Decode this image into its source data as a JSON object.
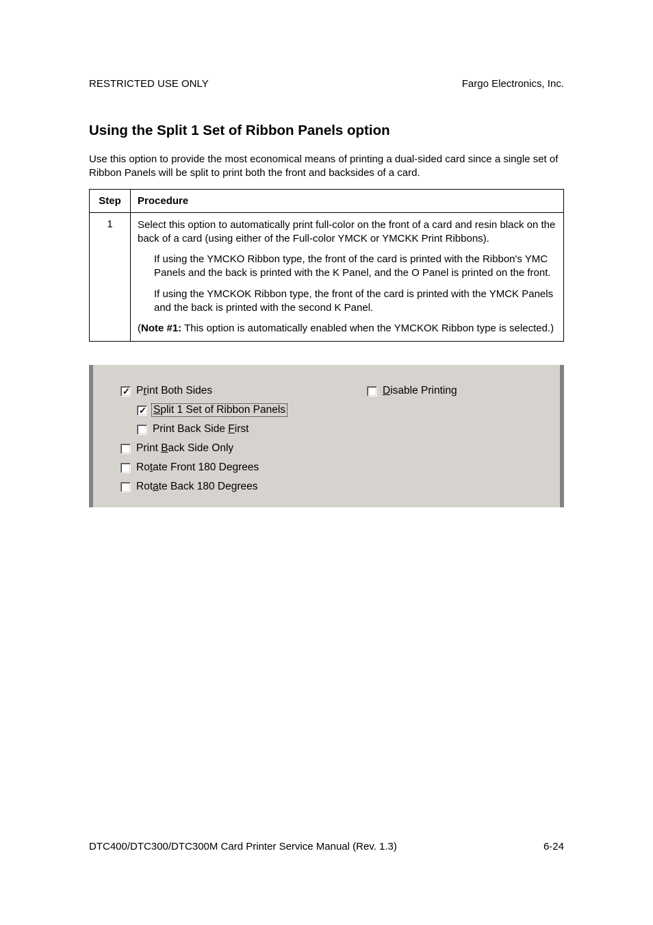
{
  "header": {
    "left": "RESTRICTED USE ONLY",
    "right": "Fargo Electronics, Inc."
  },
  "section_title": "Using the Split 1 Set of Ribbon Panels option",
  "intro": "Use this option to provide the most economical means of printing a dual-sided card since a single set of Ribbon Panels will be split to print both the front and backsides of a card.",
  "table": {
    "headers": {
      "step": "Step",
      "procedure": "Procedure"
    },
    "row": {
      "step": "1",
      "p1": "Select this option to automatically print full-color on the front of a card and resin black on the back of a card (using either of the Full-color YMCK or YMCKK Print Ribbons).",
      "p2": "If using the YMCKO Ribbon type, the front of the card is printed with the Ribbon's YMC Panels and the back is printed with the K Panel, and the O Panel is printed on the front.",
      "p3": "If using the YMCKOK Ribbon type, the front of the card is printed with the YMCK Panels and the back is printed with the second K Panel.",
      "note_label": "Note #1:",
      "note_text": "  This option is automatically enabled when the YMCKOK Ribbon type is selected.)"
    }
  },
  "dialog": {
    "print_both_sides": {
      "pre": "P",
      "u": "r",
      "post": "int Both Sides",
      "checked": true
    },
    "split_panels": {
      "pre": "",
      "u": "S",
      "post": "plit 1 Set of Ribbon Panels",
      "checked": true
    },
    "print_back_first": {
      "pre": "Print Back Side ",
      "u": "F",
      "post": "irst",
      "checked": false
    },
    "print_back_only": {
      "pre": "Print ",
      "u": "B",
      "post": "ack Side Only",
      "checked": false
    },
    "rotate_front": {
      "pre": "Ro",
      "u": "t",
      "post": "ate Front 180 Degrees",
      "checked": false
    },
    "rotate_back": {
      "pre": "Rot",
      "u": "a",
      "post": "te Back 180 Degrees",
      "checked": false
    },
    "disable_printing": {
      "pre": "",
      "u": "D",
      "post": "isable Printing",
      "checked": false
    }
  },
  "footer": {
    "left": "DTC400/DTC300/DTC300M Card Printer Service Manual (Rev. 1.3)",
    "right": "6-24"
  }
}
